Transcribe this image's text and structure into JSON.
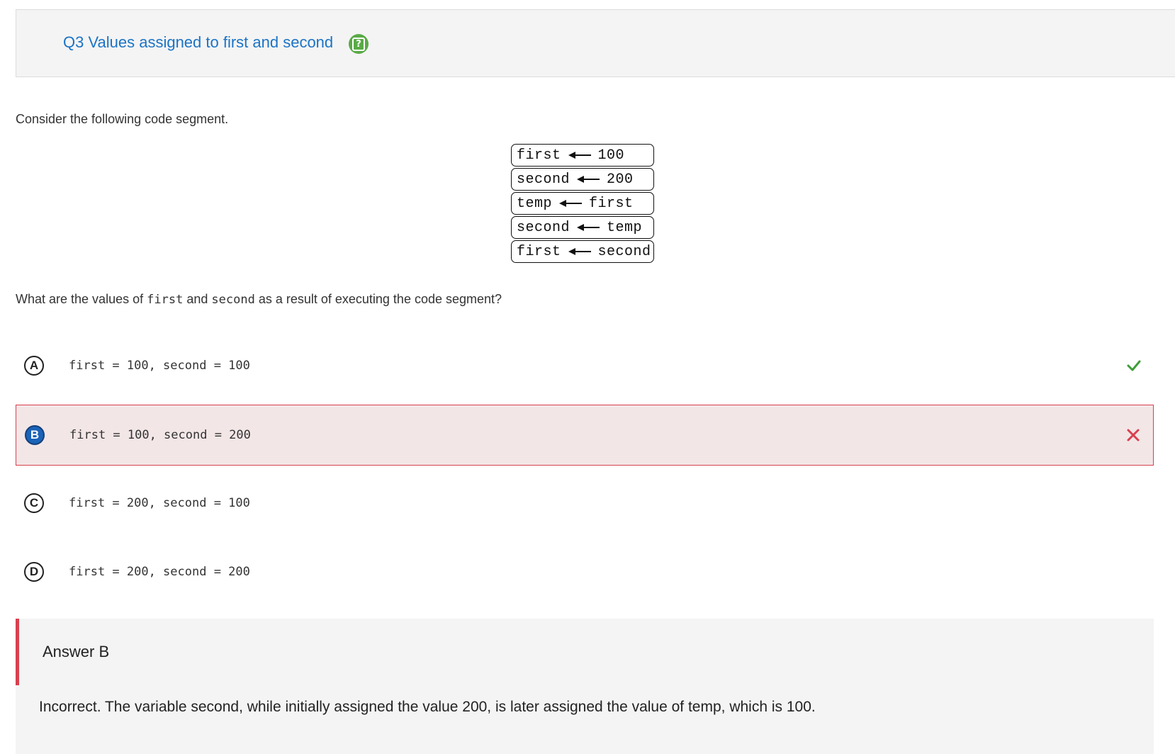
{
  "header": {
    "title": "Q3 Values assigned to first and second",
    "help_icon": "help-question-icon"
  },
  "prompt": "Consider the following code segment.",
  "code": [
    {
      "left": "first",
      "right": "100"
    },
    {
      "left": "second",
      "right": "200"
    },
    {
      "left": "temp",
      "right": "first"
    },
    {
      "left": "second",
      "right": "temp"
    },
    {
      "left": "first",
      "right": "second"
    }
  ],
  "question": {
    "before": "What are the values of",
    "var1": "first",
    "middle": "and",
    "var2": "second",
    "after": "as a result of executing the code segment?"
  },
  "options": [
    {
      "letter": "A",
      "text": "first = 100, second = 100",
      "status": "correct"
    },
    {
      "letter": "B",
      "text": "first = 100, second = 200",
      "status": "incorrect-selected"
    },
    {
      "letter": "C",
      "text": "first = 200, second = 100",
      "status": "none"
    },
    {
      "letter": "D",
      "text": "first = 200, second = 200",
      "status": "none"
    }
  ],
  "answer": {
    "title": "Answer B",
    "explanation": "Incorrect. The variable second, while initially assigned the value 200, is later assigned the value of temp, which is 100."
  },
  "colors": {
    "title_blue": "#1b74c6",
    "help_green": "#5aaa46",
    "correct_green": "#3f9d3a",
    "incorrect_red": "#d9404e",
    "selected_blue": "#1a63b8"
  }
}
